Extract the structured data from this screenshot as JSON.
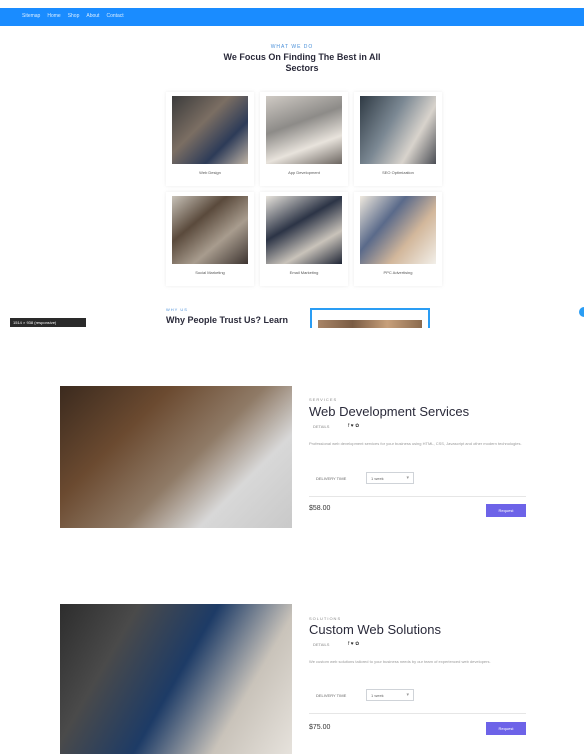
{
  "topbar": {
    "links": [
      "Sitemap",
      "Home",
      "Shop",
      "About",
      "Contact"
    ]
  },
  "services_section": {
    "subtitle": "WHAT WE DO",
    "title": "We Focus On Finding The Best in All Sectors",
    "services": [
      {
        "label": "Web Design"
      },
      {
        "label": "App Development"
      },
      {
        "label": "SEO Optimization"
      },
      {
        "label": "Social Marketing"
      },
      {
        "label": "Email Marketing"
      },
      {
        "label": "PPC Advertising"
      }
    ]
  },
  "tooltip": "1514 × 938 (responsive)",
  "trust_section": {
    "subtitle": "WHY US",
    "title": "Why People Trust Us? Learn"
  },
  "products": [
    {
      "category": "SERVICES",
      "title": "Web Development Services",
      "details_label": "DETAILS",
      "social": "f ♥ ✿",
      "description": "Professional web development services for your business using HTML, CSS, Javascript and other modern technologies.",
      "qty_label": "DELIVERY TIME",
      "qty_value": "1 week",
      "price": "$58.00",
      "button_label": "Request"
    },
    {
      "category": "SOLUTIONS",
      "title": "Custom Web Solutions",
      "details_label": "DETAILS",
      "social": "f ♥ ✿",
      "description": "We custom web solutions tailored to your business needs by our team of experienced web developers.",
      "qty_label": "DELIVERY TIME",
      "qty_value": "1 week",
      "price": "$75.00",
      "button_label": "Request"
    }
  ]
}
